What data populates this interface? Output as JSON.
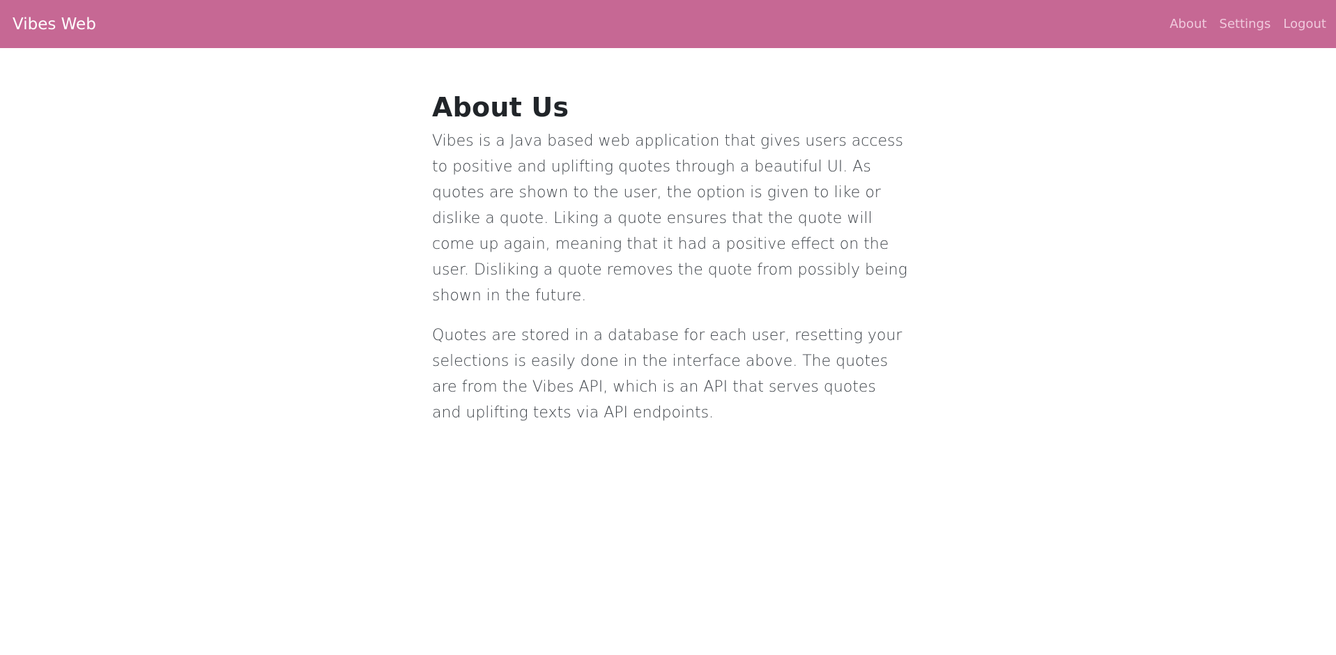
{
  "header": {
    "brand": "Vibes Web",
    "links": [
      {
        "label": "About"
      },
      {
        "label": "Settings"
      },
      {
        "label": "Logout"
      }
    ]
  },
  "main": {
    "title": "About Us",
    "paragraphs": [
      "Vibes is a Java based web application that gives users access to positive and uplifting quotes through a beautiful UI. As quotes are shown to the user, the option is given to like or dislike a quote. Liking a quote ensures that the quote will come up again, meaning that it had a positive effect on the user. Disliking a quote removes the quote from possibly being shown in the future.",
      "Quotes are stored in a database for each user, resetting your selections is easily done in the interface above. The quotes are from the Vibes API, which is an API that serves quotes and uplifting texts via API endpoints."
    ]
  },
  "colors": {
    "navbar_bg": "#c66894",
    "brand_text": "#ffffff",
    "nav_link": "#f0cadd",
    "heading": "#212529",
    "body_text": "#3d4248",
    "page_bg": "#ffffff"
  }
}
